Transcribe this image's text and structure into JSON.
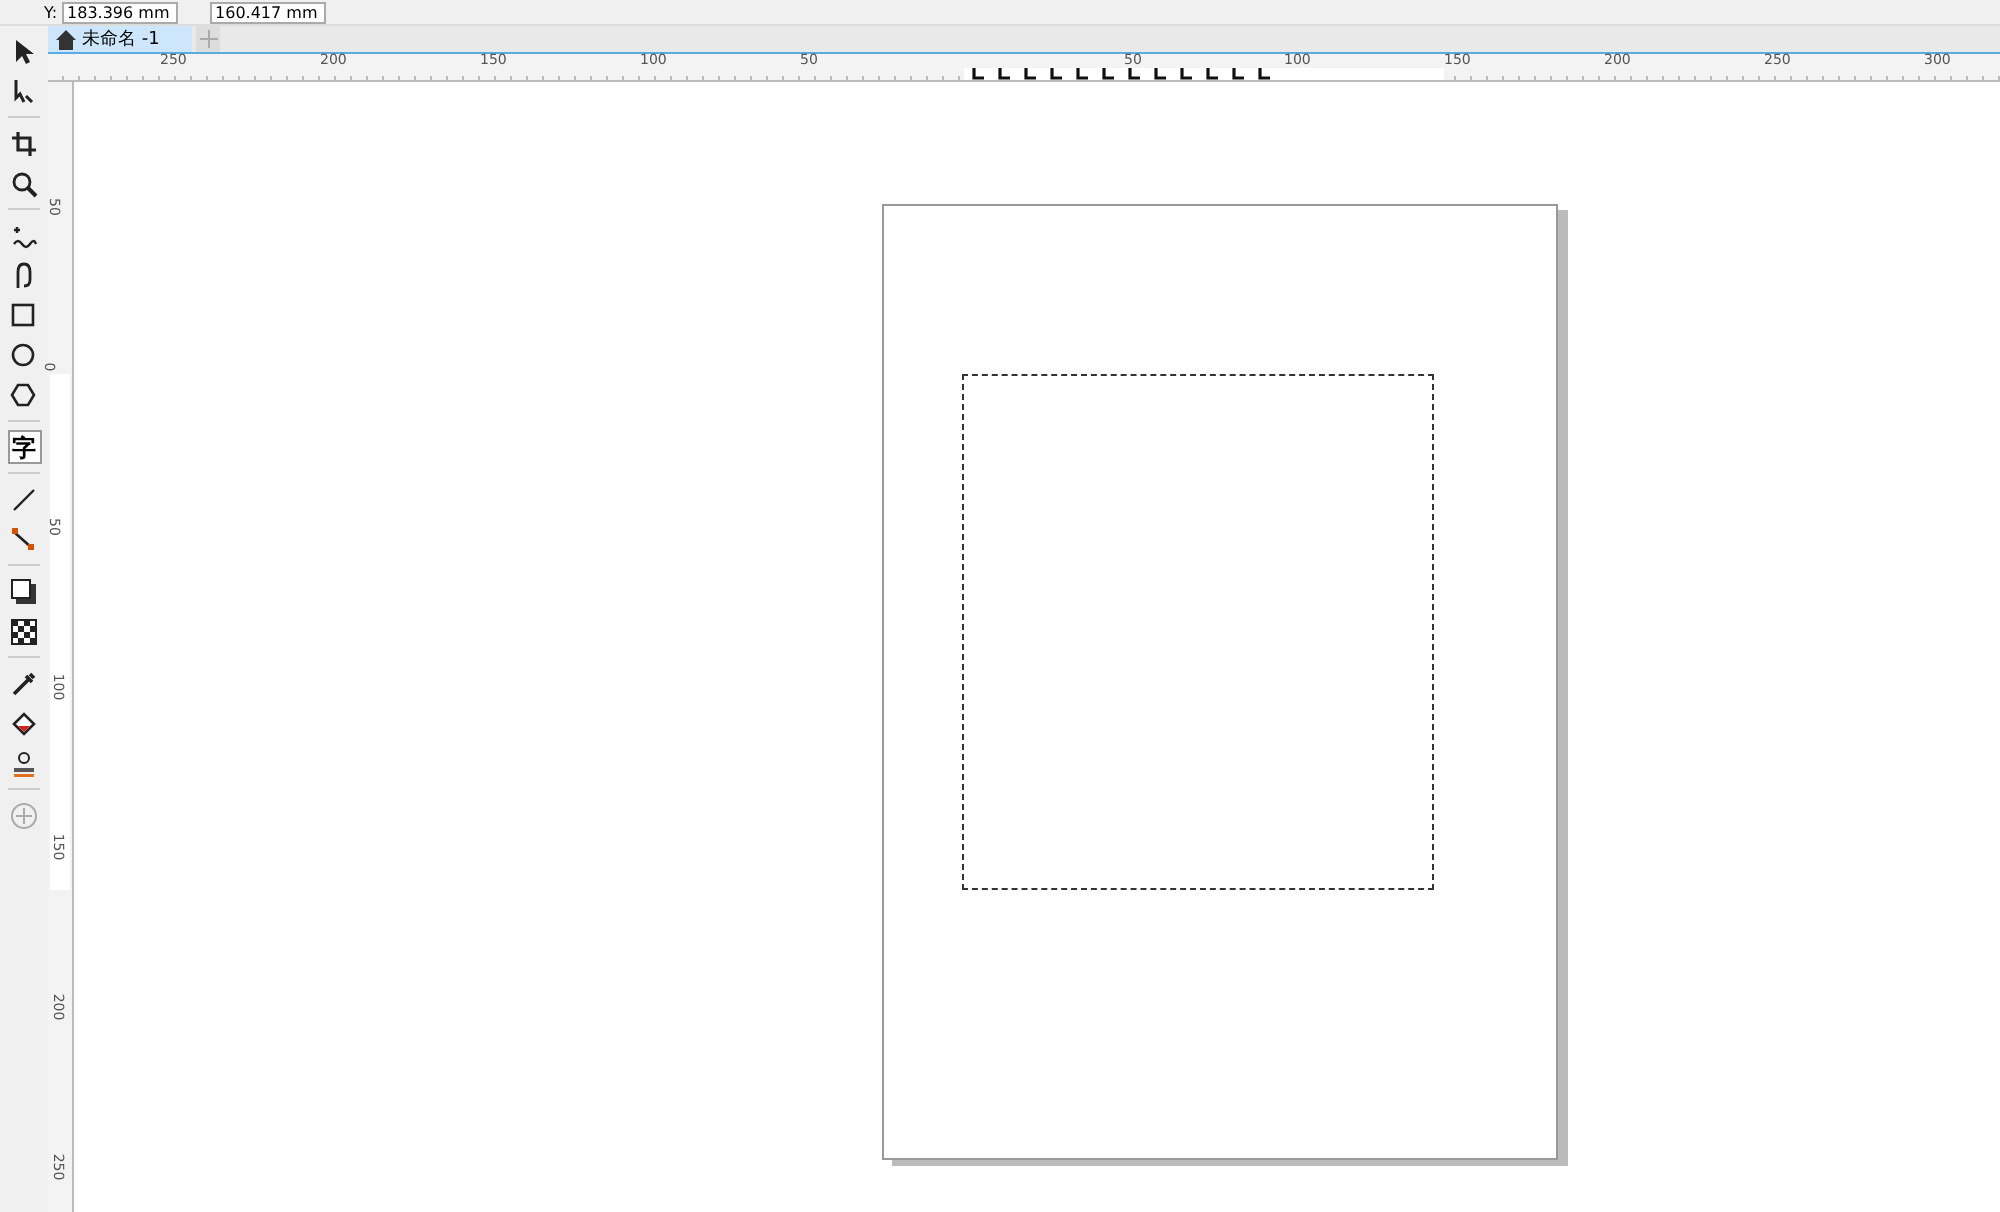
{
  "property_bar": {
    "fields": [
      {
        "label": "Y:",
        "value": "183.396 mm"
      },
      {
        "value": "160.417 mm"
      }
    ]
  },
  "document_tabs": [
    {
      "label": "未命名 -1",
      "selected": true
    }
  ],
  "horizontal_ruler": {
    "labels": [
      "250",
      "200",
      "150",
      "100",
      "50",
      "50",
      "100",
      "150",
      "200",
      "250",
      "300"
    ]
  },
  "vertical_ruler": {
    "labels": [
      "50",
      "0",
      "50",
      "100",
      "150",
      "200",
      "250"
    ]
  },
  "toolbox": [
    {
      "kind": "pick",
      "selected": false
    },
    {
      "kind": "shape",
      "selected": false
    },
    {
      "kind": "crop",
      "selected": false
    },
    {
      "kind": "zoom",
      "selected": false
    },
    {
      "kind": "freehand",
      "selected": false
    },
    {
      "kind": "curve",
      "selected": false
    },
    {
      "kind": "rectangle",
      "selected": false
    },
    {
      "kind": "ellipse",
      "selected": false
    },
    {
      "kind": "polygon",
      "selected": false
    },
    {
      "kind": "text",
      "glyph": "字",
      "selected": true
    },
    {
      "kind": "dimension",
      "selected": false
    },
    {
      "kind": "connector",
      "selected": false
    },
    {
      "kind": "shadow",
      "selected": false
    },
    {
      "kind": "transparency",
      "selected": false
    },
    {
      "kind": "eyedropper",
      "selected": false
    },
    {
      "kind": "fill",
      "selected": false
    },
    {
      "kind": "smart-fill",
      "selected": false
    },
    {
      "kind": "add",
      "selected": false
    }
  ]
}
